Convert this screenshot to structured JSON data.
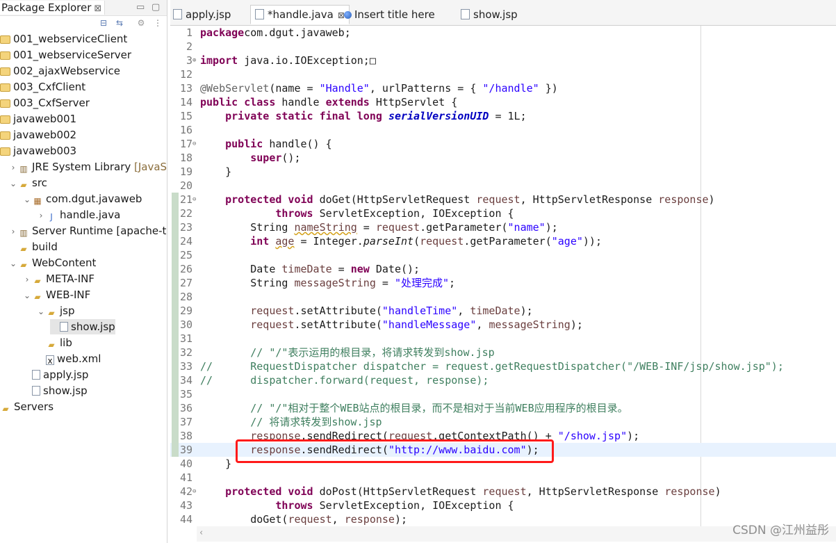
{
  "explorer": {
    "title": "Package Explorer",
    "close_glyph": "⊠",
    "tree": [
      {
        "label": "001_webserviceClient",
        "icon": "project-icon",
        "arrow": "",
        "level": 0
      },
      {
        "label": "001_webserviceServer",
        "icon": "project-icon",
        "arrow": "",
        "level": 0
      },
      {
        "label": "002_ajaxWebservice",
        "icon": "project-icon",
        "arrow": "",
        "level": 0
      },
      {
        "label": "003_CxfClient",
        "icon": "project-icon",
        "arrow": "",
        "level": 0
      },
      {
        "label": "003_CxfServer",
        "icon": "project-icon",
        "arrow": "",
        "level": 0
      },
      {
        "label": "javaweb001",
        "icon": "project-icon",
        "arrow": "",
        "level": 0
      },
      {
        "label": "javaweb002",
        "icon": "project-icon",
        "arrow": "",
        "level": 0
      },
      {
        "label": "javaweb003",
        "icon": "project-icon",
        "arrow": "",
        "level": 0
      },
      {
        "label": "JRE System Library",
        "suffix": " [JavaSE",
        "icon": "library-icon",
        "arrow": "›",
        "level": 1
      },
      {
        "label": "src",
        "icon": "source-folder-icon",
        "arrow": "⌄",
        "level": 1
      },
      {
        "label": "com.dgut.javaweb",
        "icon": "package-icon",
        "arrow": "⌄",
        "level": 2
      },
      {
        "label": "handle.java",
        "icon": "java-file-icon",
        "arrow": "›",
        "level": 3
      },
      {
        "label": "Server Runtime [apache-tc",
        "icon": "library-icon",
        "arrow": "›",
        "level": 1
      },
      {
        "label": "build",
        "icon": "folder-icon",
        "arrow": "",
        "level": 1
      },
      {
        "label": "WebContent",
        "icon": "folder-icon",
        "arrow": "⌄",
        "level": 1
      },
      {
        "label": "META-INF",
        "icon": "folder-icon",
        "arrow": "›",
        "level": 2
      },
      {
        "label": "WEB-INF",
        "icon": "folder-icon",
        "arrow": "⌄",
        "level": 2
      },
      {
        "label": "jsp",
        "icon": "folder-icon",
        "arrow": "⌄",
        "level": 3
      },
      {
        "label": "show.jsp",
        "icon": "file-icon",
        "arrow": "",
        "level": 4,
        "selected": true
      },
      {
        "label": "lib",
        "icon": "folder-icon",
        "arrow": "",
        "level": 3
      },
      {
        "label": "web.xml",
        "icon": "xml-file-icon",
        "arrow": "",
        "level": 3
      },
      {
        "label": "apply.jsp",
        "icon": "file-icon",
        "arrow": "",
        "level": 2
      },
      {
        "label": "show.jsp",
        "icon": "file-icon",
        "arrow": "",
        "level": 2
      },
      {
        "label": "Servers",
        "icon": "folder-icon",
        "arrow": "",
        "level": 0
      }
    ]
  },
  "tabs": [
    {
      "label": "apply.jsp",
      "icon": "file-icon",
      "active": false
    },
    {
      "label": "*handle.java",
      "icon": "java-file-icon",
      "active": true,
      "close": "⊠"
    },
    {
      "label": "Insert title here",
      "icon": "globe-icon",
      "active": false
    },
    {
      "label": "show.jsp",
      "icon": "file-icon",
      "active": false
    }
  ],
  "code_lines": [
    {
      "n": "1",
      "segs": [
        [
          "kw",
          "package"
        ],
        [
          "",
          "com.dgut.javaweb;"
        ]
      ]
    },
    {
      "n": "2",
      "segs": []
    },
    {
      "n": "3",
      "mk": "⊕",
      "segs": [
        [
          "kw",
          "import"
        ],
        [
          "",
          " java.io.IOException;"
        ],
        [
          "",
          "□"
        ]
      ]
    },
    {
      "n": "12",
      "segs": []
    },
    {
      "n": "13",
      "segs": [
        [
          "ann",
          "@WebServlet"
        ],
        [
          "",
          "(name = "
        ],
        [
          "str",
          "\"Handle\""
        ],
        [
          "",
          ", urlPatterns = { "
        ],
        [
          "str",
          "\"/handle\""
        ],
        [
          "",
          " })"
        ]
      ]
    },
    {
      "n": "14",
      "segs": [
        [
          "kw",
          "public class"
        ],
        [
          "",
          " handle "
        ],
        [
          "kw",
          "extends"
        ],
        [
          "",
          " HttpServlet {"
        ]
      ]
    },
    {
      "n": "15",
      "segs": [
        [
          "",
          "    "
        ],
        [
          "kw",
          "private static final long"
        ],
        [
          "",
          " "
        ],
        [
          "fld",
          "serialVersionUID"
        ],
        [
          "",
          " = 1L;"
        ]
      ]
    },
    {
      "n": "16",
      "segs": []
    },
    {
      "n": "17",
      "mk": "⊖",
      "segs": [
        [
          "",
          "    "
        ],
        [
          "kw",
          "public"
        ],
        [
          "",
          " handle() {"
        ]
      ]
    },
    {
      "n": "18",
      "segs": [
        [
          "",
          "        "
        ],
        [
          "kw",
          "super"
        ],
        [
          "",
          "();"
        ]
      ]
    },
    {
      "n": "19",
      "segs": [
        [
          "",
          "    }"
        ]
      ]
    },
    {
      "n": "20",
      "segs": []
    },
    {
      "n": "21",
      "mk": "⊖",
      "chg": true,
      "segs": [
        [
          "",
          "    "
        ],
        [
          "kw",
          "protected void"
        ],
        [
          "",
          " doGet(HttpServletRequest "
        ],
        [
          "var",
          "request"
        ],
        [
          "",
          ", HttpServletResponse "
        ],
        [
          "var",
          "response"
        ],
        [
          "",
          ")"
        ]
      ]
    },
    {
      "n": "22",
      "chg": true,
      "segs": [
        [
          "",
          "            "
        ],
        [
          "kw",
          "throws"
        ],
        [
          "",
          " ServletException, IOException {"
        ]
      ]
    },
    {
      "n": "23",
      "chg": true,
      "segs": [
        [
          "",
          "        String "
        ],
        [
          "var sq",
          "nameString"
        ],
        [
          "",
          " = "
        ],
        [
          "var",
          "request"
        ],
        [
          "",
          ".getParameter("
        ],
        [
          "str",
          "\"name\""
        ],
        [
          "",
          ");"
        ]
      ]
    },
    {
      "n": "24",
      "chg": true,
      "segs": [
        [
          "",
          "        "
        ],
        [
          "kw",
          "int"
        ],
        [
          "",
          " "
        ],
        [
          "var sq",
          "age"
        ],
        [
          "",
          " = Integer."
        ],
        [
          "it",
          "parseInt"
        ],
        [
          "",
          "("
        ],
        [
          "var",
          "request"
        ],
        [
          "",
          ".getParameter("
        ],
        [
          "str",
          "\"age\""
        ],
        [
          "",
          "));"
        ]
      ]
    },
    {
      "n": "25",
      "chg": true,
      "segs": []
    },
    {
      "n": "26",
      "chg": true,
      "segs": [
        [
          "",
          "        Date "
        ],
        [
          "var",
          "timeDate"
        ],
        [
          "",
          " = "
        ],
        [
          "kw",
          "new"
        ],
        [
          "",
          " Date();"
        ]
      ]
    },
    {
      "n": "27",
      "chg": true,
      "segs": [
        [
          "",
          "        String "
        ],
        [
          "var",
          "messageString"
        ],
        [
          "",
          " = "
        ],
        [
          "str",
          "\"处理完成\""
        ],
        [
          "",
          ";"
        ]
      ]
    },
    {
      "n": "28",
      "chg": true,
      "segs": []
    },
    {
      "n": "29",
      "chg": true,
      "segs": [
        [
          "",
          "        "
        ],
        [
          "var",
          "request"
        ],
        [
          "",
          ".setAttribute("
        ],
        [
          "str",
          "\"handleTime\""
        ],
        [
          "",
          ", "
        ],
        [
          "var",
          "timeDate"
        ],
        [
          "",
          ");"
        ]
      ]
    },
    {
      "n": "30",
      "chg": true,
      "segs": [
        [
          "",
          "        "
        ],
        [
          "var",
          "request"
        ],
        [
          "",
          ".setAttribute("
        ],
        [
          "str",
          "\"handleMessage\""
        ],
        [
          "",
          ", "
        ],
        [
          "var",
          "messageString"
        ],
        [
          "",
          ");"
        ]
      ]
    },
    {
      "n": "31",
      "chg": true,
      "segs": []
    },
    {
      "n": "32",
      "chg": true,
      "segs": [
        [
          "cm",
          "        // \"/\"表示运用的根目录，将请求转发到show.jsp"
        ]
      ]
    },
    {
      "n": "33",
      "chg": true,
      "segs": [
        [
          "cm",
          "//      RequestDispatcher dispatcher = request.getRequestDispatcher(\"/WEB-INF/jsp/show.jsp\");"
        ]
      ]
    },
    {
      "n": "34",
      "chg": true,
      "segs": [
        [
          "cm",
          "//      dispatcher.forward(request, response);"
        ]
      ]
    },
    {
      "n": "35",
      "chg": true,
      "segs": []
    },
    {
      "n": "36",
      "chg": true,
      "segs": [
        [
          "cm",
          "        // \"/\"相对于整个WEB站点的根目录，而不是相对于当前WEB应用程序的根目录。"
        ]
      ]
    },
    {
      "n": "37",
      "chg": true,
      "segs": [
        [
          "cm",
          "        // 将请求转发到show.jsp"
        ]
      ]
    },
    {
      "n": "38",
      "chg": true,
      "segs": [
        [
          "",
          "        "
        ],
        [
          "var",
          "response"
        ],
        [
          "",
          ".sendRedirect("
        ],
        [
          "var",
          "request"
        ],
        [
          "",
          ".getContextPath() + "
        ],
        [
          "str",
          "\"/show.jsp\""
        ],
        [
          "",
          ");"
        ]
      ]
    },
    {
      "n": "39",
      "chg": true,
      "hl": true,
      "segs": [
        [
          "",
          "        "
        ],
        [
          "var",
          "response"
        ],
        [
          "",
          ".sendRedirect("
        ],
        [
          "str",
          "\"http://www.baidu.com\""
        ],
        [
          "",
          ");"
        ]
      ]
    },
    {
      "n": "40",
      "segs": [
        [
          "",
          "    }"
        ]
      ]
    },
    {
      "n": "41",
      "segs": []
    },
    {
      "n": "42",
      "mk": "⊖",
      "segs": [
        [
          "",
          "    "
        ],
        [
          "kw",
          "protected void"
        ],
        [
          "",
          " doPost(HttpServletRequest "
        ],
        [
          "var",
          "request"
        ],
        [
          "",
          ", HttpServletResponse "
        ],
        [
          "var",
          "response"
        ],
        [
          "",
          ")"
        ]
      ]
    },
    {
      "n": "43",
      "segs": [
        [
          "",
          "            "
        ],
        [
          "kw",
          "throws"
        ],
        [
          "",
          " ServletException, IOException {"
        ]
      ]
    },
    {
      "n": "44",
      "segs": [
        [
          "",
          "        doGet("
        ],
        [
          "var",
          "request"
        ],
        [
          "",
          ", "
        ],
        [
          "var",
          "response"
        ],
        [
          "",
          ");"
        ]
      ]
    }
  ],
  "watermark": "CSDN @江州益彤",
  "colors": {
    "keyword": "#7f0055",
    "string": "#2a00ff",
    "comment": "#3f7f5f",
    "highlight_box": "#ff1a1a"
  }
}
